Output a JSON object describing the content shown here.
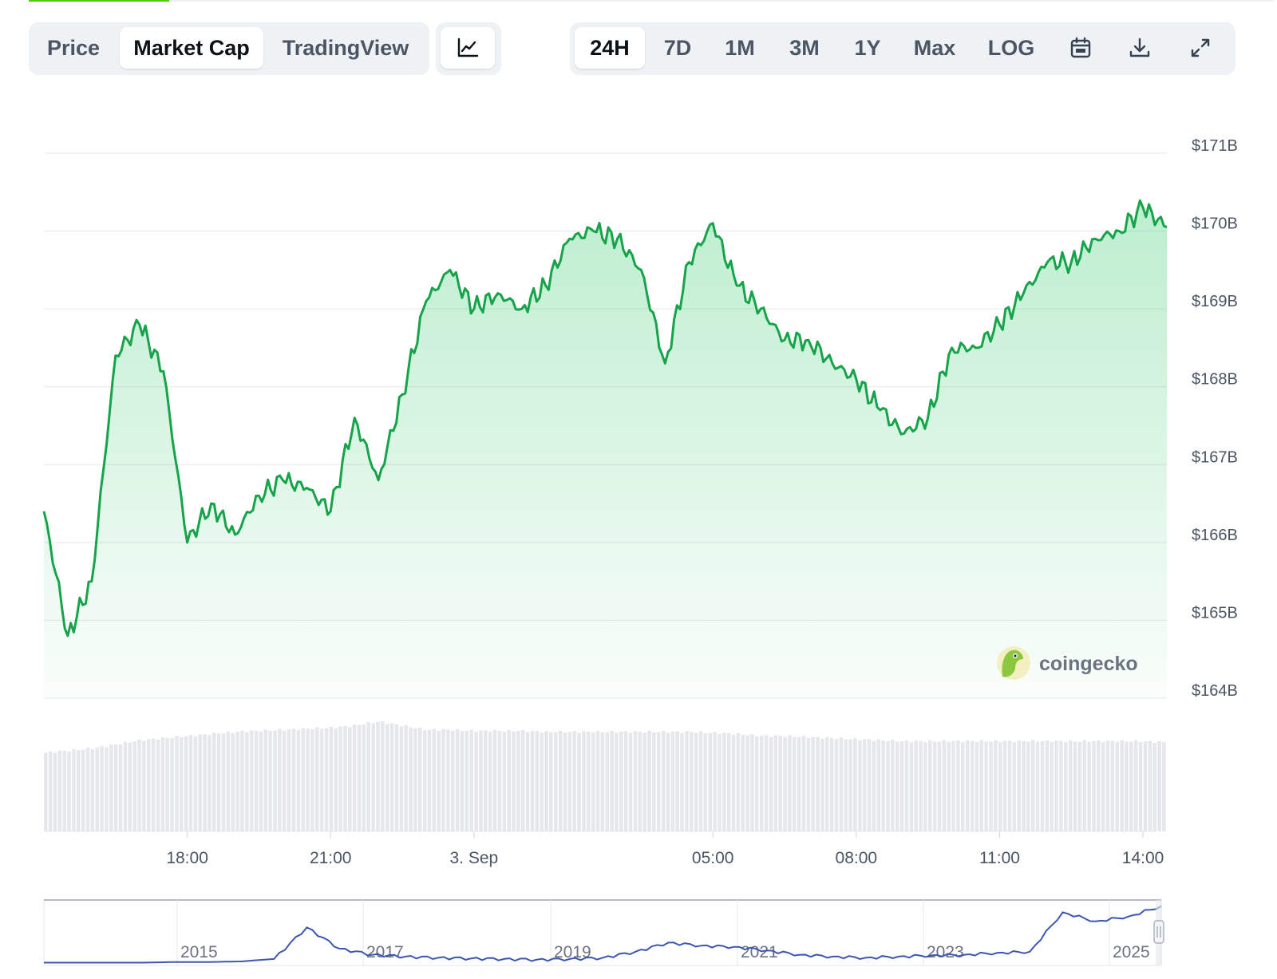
{
  "tabs": [
    {
      "label": "Price",
      "active": false
    },
    {
      "label": "Market Cap",
      "active": true
    },
    {
      "label": "TradingView",
      "active": false
    }
  ],
  "chart_style_icon": "line-chart-icon",
  "ranges": [
    {
      "label": "24H",
      "active": true
    },
    {
      "label": "7D",
      "active": false
    },
    {
      "label": "1M",
      "active": false
    },
    {
      "label": "3M",
      "active": false
    },
    {
      "label": "1Y",
      "active": false
    },
    {
      "label": "Max",
      "active": false
    },
    {
      "label": "LOG",
      "active": false
    }
  ],
  "tool_icons": [
    "calendar-icon",
    "download-icon",
    "fullscreen-icon"
  ],
  "watermark": "coingecko",
  "colors": {
    "line": "#16a34a",
    "fill": "#22c55e",
    "volume": "#e5e7eb",
    "navigator": "#3d56b2",
    "accent": "#4bcc00"
  },
  "chart_data": {
    "type": "area",
    "series": [
      {
        "x": [
          "15:00",
          "15:30",
          "16:00",
          "16:30",
          "17:00",
          "17:30",
          "18:00",
          "18:30",
          "19:00",
          "19:30",
          "20:00",
          "20:30",
          "21:00",
          "21:30",
          "22:00",
          "22:30",
          "23:00",
          "23:30",
          "00:00",
          "00:30",
          "01:00",
          "01:30",
          "02:00",
          "02:30",
          "03:00",
          "03:30",
          "04:00",
          "04:30",
          "05:00",
          "05:30",
          "06:00",
          "06:30",
          "07:00",
          "07:30",
          "08:00",
          "08:30",
          "09:00",
          "09:30",
          "10:00",
          "10:30",
          "11:00",
          "11:30",
          "12:00",
          "12:30",
          "13:00",
          "13:30",
          "14:00",
          "14:30"
        ],
        "y": [
          166.4,
          164.8,
          165.5,
          168.4,
          168.8,
          168.2,
          166.0,
          166.5,
          166.1,
          166.6,
          166.8,
          166.7,
          166.4,
          167.6,
          166.8,
          167.9,
          169.1,
          169.5,
          169.0,
          169.2,
          169.0,
          169.3,
          169.9,
          170.0,
          169.9,
          169.5,
          168.3,
          169.6,
          170.1,
          169.3,
          169.0,
          168.6,
          168.6,
          168.3,
          168.1,
          167.7,
          167.4,
          167.6,
          168.5,
          168.5,
          168.8,
          169.2,
          169.6,
          169.6,
          169.9,
          170.0,
          170.3,
          170.05
        ]
      }
    ],
    "x_ticks": [
      "18:00",
      "21:00",
      "3. Sep",
      "05:00",
      "08:00",
      "11:00",
      "14:00"
    ],
    "y_ticks": [
      "$171B",
      "$170B",
      "$169B",
      "$168B",
      "$167B",
      "$166B",
      "$165B",
      "$164B"
    ],
    "ylim": [
      164,
      171
    ],
    "volume": [
      3.8,
      3.9,
      4.0,
      4.2,
      4.4,
      4.5,
      4.6,
      4.7,
      4.8,
      4.85,
      4.9,
      4.95,
      5.0,
      5.1,
      5.3,
      5.1,
      4.9,
      4.9,
      4.85,
      4.85,
      4.85,
      4.8,
      4.8,
      4.8,
      4.8,
      4.8,
      4.8,
      4.8,
      4.75,
      4.7,
      4.6,
      4.6,
      4.55,
      4.5,
      4.45,
      4.4,
      4.35,
      4.35,
      4.35,
      4.35,
      4.35,
      4.35,
      4.35,
      4.35,
      4.35,
      4.35,
      4.35,
      4.3
    ],
    "navigator": {
      "years": [
        "2015",
        "2017",
        "2019",
        "2021",
        "2023",
        "2025"
      ],
      "series": [
        0.02,
        0.02,
        0.02,
        0.02,
        0.03,
        0.03,
        0.04,
        0.08,
        0.6,
        0.25,
        0.15,
        0.12,
        0.1,
        0.09,
        0.08,
        0.07,
        0.08,
        0.1,
        0.2,
        0.35,
        0.3,
        0.28,
        0.22,
        0.15,
        0.12,
        0.1,
        0.12,
        0.14,
        0.15,
        0.18,
        0.2,
        0.85,
        0.7,
        0.78,
        0.95
      ]
    }
  }
}
